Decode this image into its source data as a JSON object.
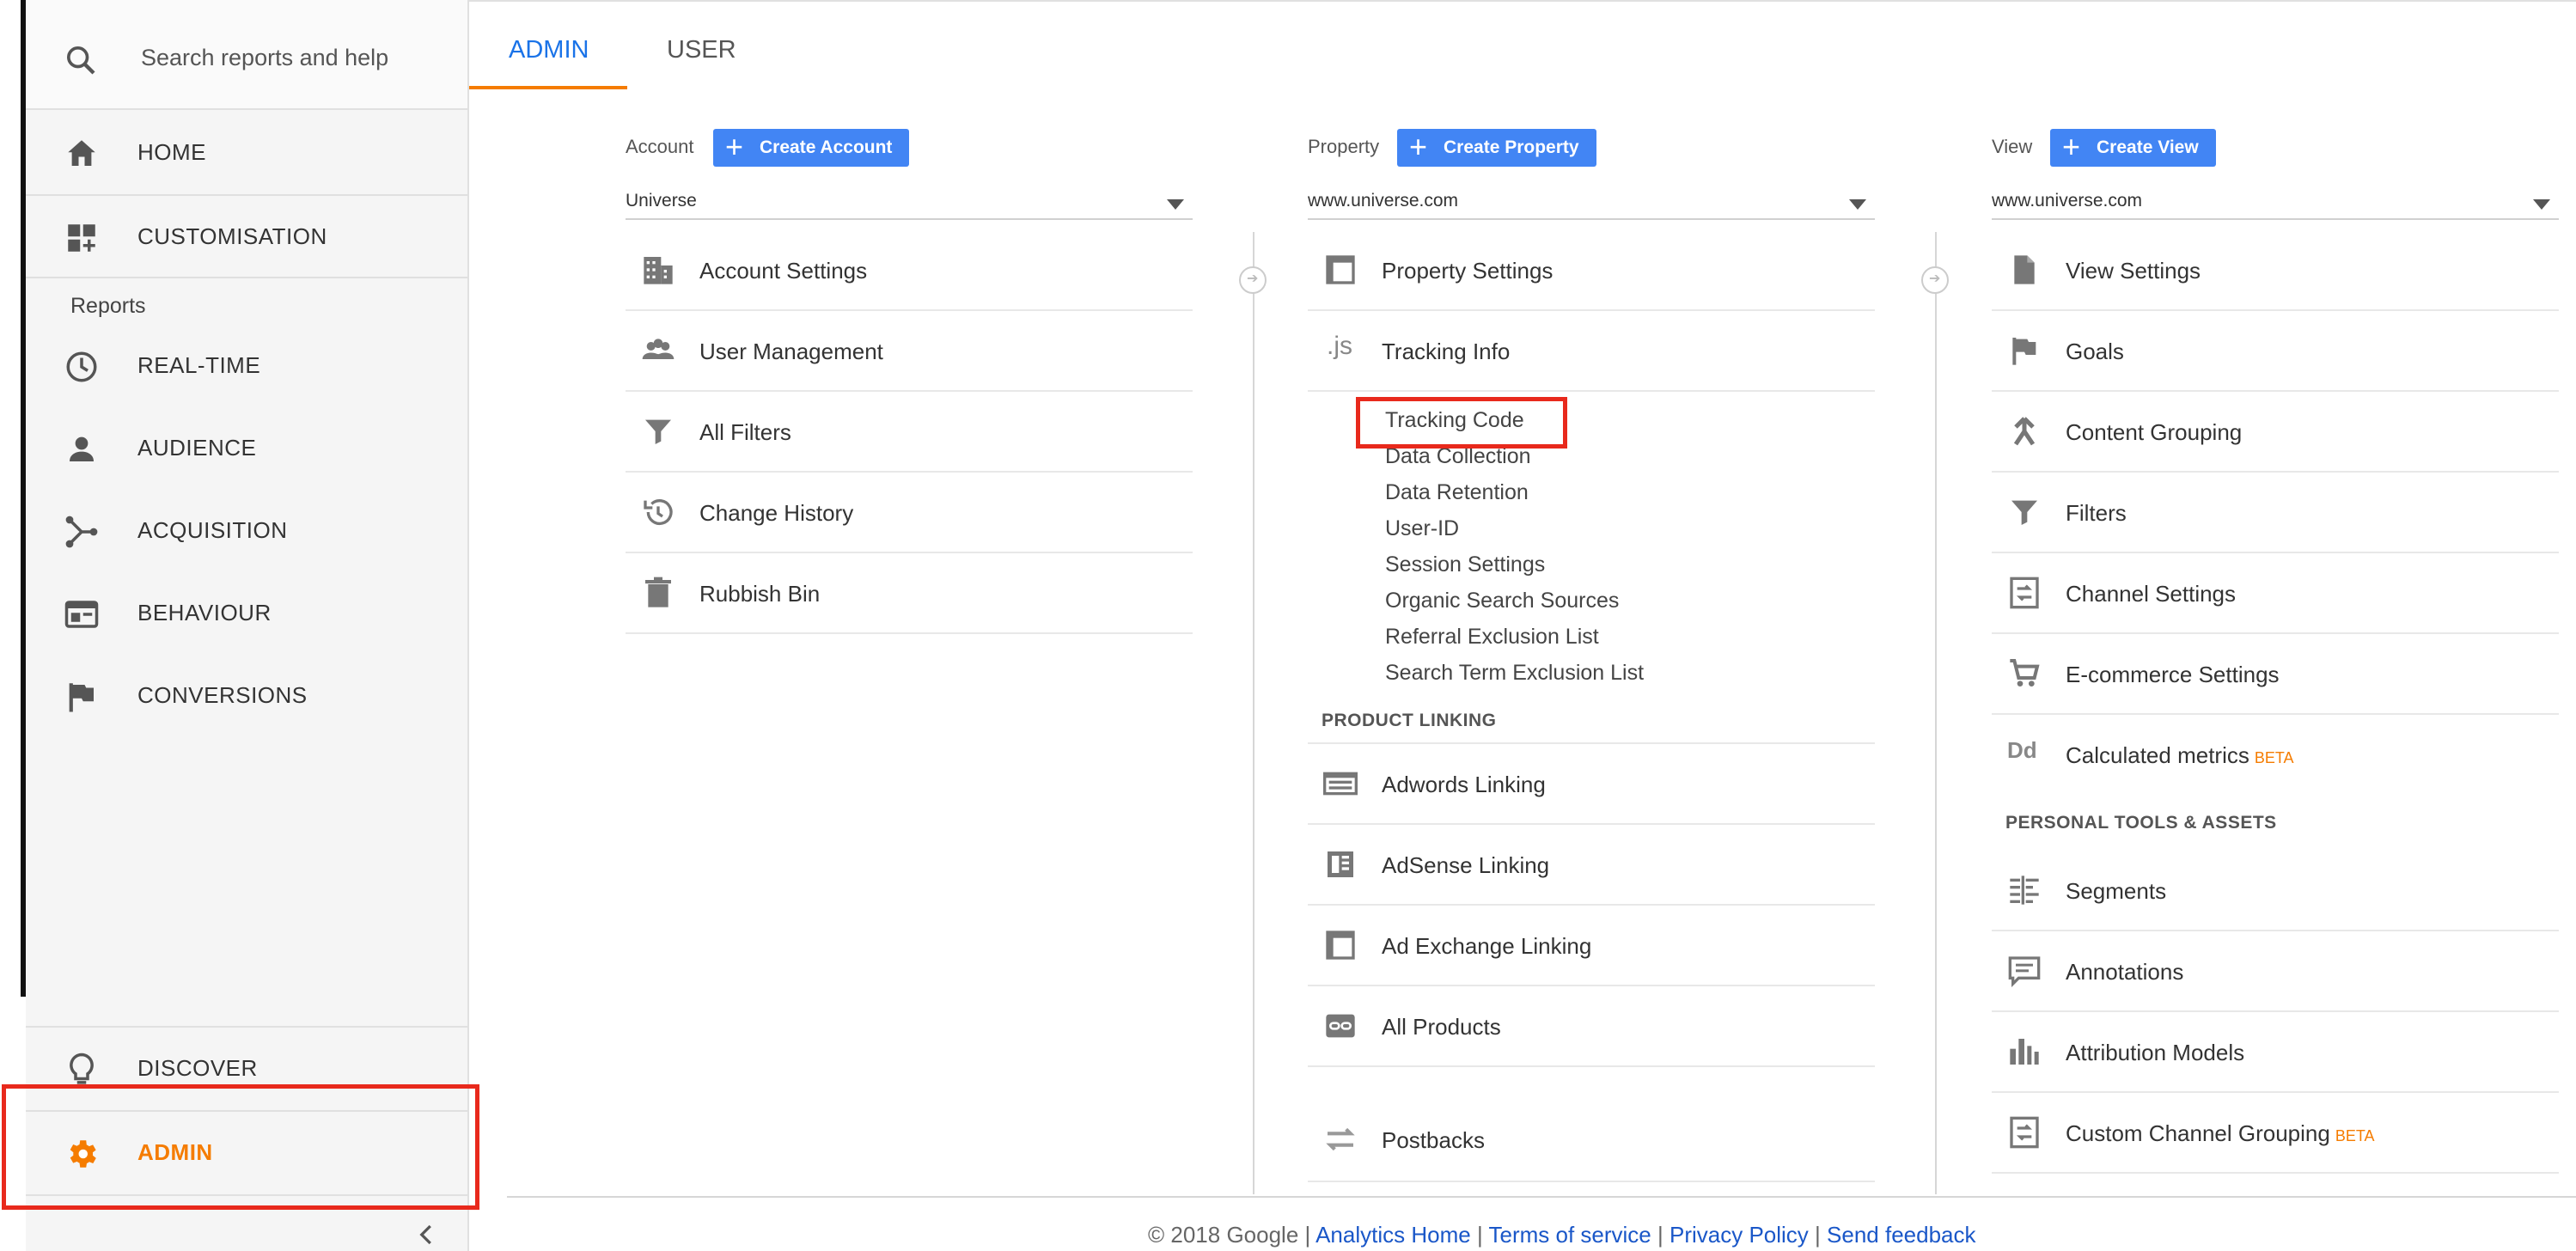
{
  "sidebar": {
    "search_placeholder": "Search reports and help",
    "home": "HOME",
    "customisation": "CUSTOMISATION",
    "reports_label": "Reports",
    "realtime": "REAL-TIME",
    "audience": "AUDIENCE",
    "acquisition": "ACQUISITION",
    "behaviour": "BEHAVIOUR",
    "conversions": "CONVERSIONS",
    "discover": "DISCOVER",
    "admin": "ADMIN"
  },
  "tabs": {
    "admin": "ADMIN",
    "user": "USER"
  },
  "account": {
    "label": "Account",
    "create": "Create Account",
    "selected": "Universe",
    "items": [
      "Account Settings",
      "User Management",
      "All Filters",
      "Change History",
      "Rubbish Bin"
    ]
  },
  "property": {
    "label": "Property",
    "create": "Create Property",
    "selected": "www.universe.com",
    "settings": "Property Settings",
    "tracking_info": "Tracking Info",
    "tracking_sub": [
      "Tracking Code",
      "Data Collection",
      "Data Retention",
      "User-ID",
      "Session Settings",
      "Organic Search Sources",
      "Referral Exclusion List",
      "Search Term Exclusion List"
    ],
    "product_linking_title": "PRODUCT LINKING",
    "linking": [
      "Adwords Linking",
      "AdSense Linking",
      "Ad Exchange Linking",
      "All Products"
    ],
    "postbacks": "Postbacks"
  },
  "view": {
    "label": "View",
    "create": "Create View",
    "selected": "www.universe.com",
    "items": [
      "View Settings",
      "Goals",
      "Content Grouping",
      "Filters",
      "Channel Settings",
      "E-commerce Settings",
      "Calculated metrics"
    ],
    "calculated_beta": "BETA",
    "personal_title": "PERSONAL TOOLS & ASSETS",
    "personal": [
      "Segments",
      "Annotations",
      "Attribution Models",
      "Custom Channel Grouping"
    ],
    "custom_beta": "BETA"
  },
  "footer": {
    "copyright": "© 2018 Google",
    "sep": "|",
    "links": [
      "Analytics Home",
      "Terms of service",
      "Privacy Policy",
      "Send feedback"
    ]
  },
  "colors": {
    "accent": "#f57c00",
    "primary": "#4285f4",
    "highlight": "#e8291c"
  }
}
